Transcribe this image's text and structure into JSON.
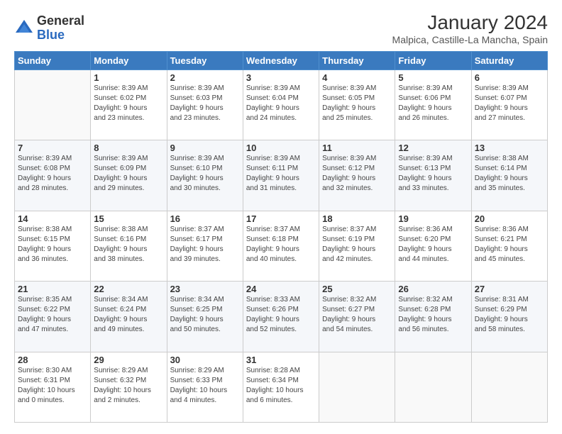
{
  "logo": {
    "general": "General",
    "blue": "Blue"
  },
  "title": "January 2024",
  "subtitle": "Malpica, Castille-La Mancha, Spain",
  "headers": [
    "Sunday",
    "Monday",
    "Tuesday",
    "Wednesday",
    "Thursday",
    "Friday",
    "Saturday"
  ],
  "weeks": [
    [
      {
        "day": "",
        "info": ""
      },
      {
        "day": "1",
        "info": "Sunrise: 8:39 AM\nSunset: 6:02 PM\nDaylight: 9 hours\nand 23 minutes."
      },
      {
        "day": "2",
        "info": "Sunrise: 8:39 AM\nSunset: 6:03 PM\nDaylight: 9 hours\nand 23 minutes."
      },
      {
        "day": "3",
        "info": "Sunrise: 8:39 AM\nSunset: 6:04 PM\nDaylight: 9 hours\nand 24 minutes."
      },
      {
        "day": "4",
        "info": "Sunrise: 8:39 AM\nSunset: 6:05 PM\nDaylight: 9 hours\nand 25 minutes."
      },
      {
        "day": "5",
        "info": "Sunrise: 8:39 AM\nSunset: 6:06 PM\nDaylight: 9 hours\nand 26 minutes."
      },
      {
        "day": "6",
        "info": "Sunrise: 8:39 AM\nSunset: 6:07 PM\nDaylight: 9 hours\nand 27 minutes."
      }
    ],
    [
      {
        "day": "7",
        "info": "Sunrise: 8:39 AM\nSunset: 6:08 PM\nDaylight: 9 hours\nand 28 minutes."
      },
      {
        "day": "8",
        "info": "Sunrise: 8:39 AM\nSunset: 6:09 PM\nDaylight: 9 hours\nand 29 minutes."
      },
      {
        "day": "9",
        "info": "Sunrise: 8:39 AM\nSunset: 6:10 PM\nDaylight: 9 hours\nand 30 minutes."
      },
      {
        "day": "10",
        "info": "Sunrise: 8:39 AM\nSunset: 6:11 PM\nDaylight: 9 hours\nand 31 minutes."
      },
      {
        "day": "11",
        "info": "Sunrise: 8:39 AM\nSunset: 6:12 PM\nDaylight: 9 hours\nand 32 minutes."
      },
      {
        "day": "12",
        "info": "Sunrise: 8:39 AM\nSunset: 6:13 PM\nDaylight: 9 hours\nand 33 minutes."
      },
      {
        "day": "13",
        "info": "Sunrise: 8:38 AM\nSunset: 6:14 PM\nDaylight: 9 hours\nand 35 minutes."
      }
    ],
    [
      {
        "day": "14",
        "info": "Sunrise: 8:38 AM\nSunset: 6:15 PM\nDaylight: 9 hours\nand 36 minutes."
      },
      {
        "day": "15",
        "info": "Sunrise: 8:38 AM\nSunset: 6:16 PM\nDaylight: 9 hours\nand 38 minutes."
      },
      {
        "day": "16",
        "info": "Sunrise: 8:37 AM\nSunset: 6:17 PM\nDaylight: 9 hours\nand 39 minutes."
      },
      {
        "day": "17",
        "info": "Sunrise: 8:37 AM\nSunset: 6:18 PM\nDaylight: 9 hours\nand 40 minutes."
      },
      {
        "day": "18",
        "info": "Sunrise: 8:37 AM\nSunset: 6:19 PM\nDaylight: 9 hours\nand 42 minutes."
      },
      {
        "day": "19",
        "info": "Sunrise: 8:36 AM\nSunset: 6:20 PM\nDaylight: 9 hours\nand 44 minutes."
      },
      {
        "day": "20",
        "info": "Sunrise: 8:36 AM\nSunset: 6:21 PM\nDaylight: 9 hours\nand 45 minutes."
      }
    ],
    [
      {
        "day": "21",
        "info": "Sunrise: 8:35 AM\nSunset: 6:22 PM\nDaylight: 9 hours\nand 47 minutes."
      },
      {
        "day": "22",
        "info": "Sunrise: 8:34 AM\nSunset: 6:24 PM\nDaylight: 9 hours\nand 49 minutes."
      },
      {
        "day": "23",
        "info": "Sunrise: 8:34 AM\nSunset: 6:25 PM\nDaylight: 9 hours\nand 50 minutes."
      },
      {
        "day": "24",
        "info": "Sunrise: 8:33 AM\nSunset: 6:26 PM\nDaylight: 9 hours\nand 52 minutes."
      },
      {
        "day": "25",
        "info": "Sunrise: 8:32 AM\nSunset: 6:27 PM\nDaylight: 9 hours\nand 54 minutes."
      },
      {
        "day": "26",
        "info": "Sunrise: 8:32 AM\nSunset: 6:28 PM\nDaylight: 9 hours\nand 56 minutes."
      },
      {
        "day": "27",
        "info": "Sunrise: 8:31 AM\nSunset: 6:29 PM\nDaylight: 9 hours\nand 58 minutes."
      }
    ],
    [
      {
        "day": "28",
        "info": "Sunrise: 8:30 AM\nSunset: 6:31 PM\nDaylight: 10 hours\nand 0 minutes."
      },
      {
        "day": "29",
        "info": "Sunrise: 8:29 AM\nSunset: 6:32 PM\nDaylight: 10 hours\nand 2 minutes."
      },
      {
        "day": "30",
        "info": "Sunrise: 8:29 AM\nSunset: 6:33 PM\nDaylight: 10 hours\nand 4 minutes."
      },
      {
        "day": "31",
        "info": "Sunrise: 8:28 AM\nSunset: 6:34 PM\nDaylight: 10 hours\nand 6 minutes."
      },
      {
        "day": "",
        "info": ""
      },
      {
        "day": "",
        "info": ""
      },
      {
        "day": "",
        "info": ""
      }
    ]
  ]
}
